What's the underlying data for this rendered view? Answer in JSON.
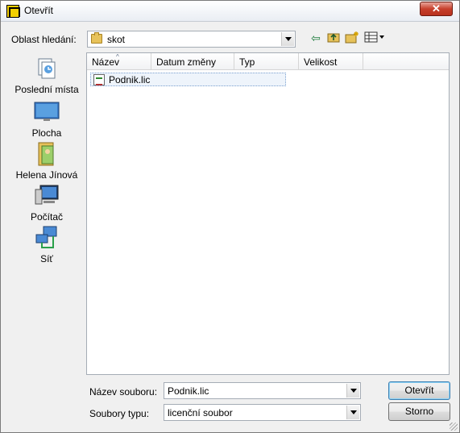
{
  "window": {
    "title": "Otevřít",
    "close_label": "✕"
  },
  "look_in": {
    "label": "Oblast hledání:",
    "value": "skot"
  },
  "toolbar": {
    "back_icon": "back-arrow-icon",
    "up_icon": "up-folder-icon",
    "new_folder_icon": "new-folder-icon",
    "views_icon": "views-menu-icon"
  },
  "places": [
    {
      "label": "Poslední místa",
      "icon": "recent-places-icon"
    },
    {
      "label": "Plocha",
      "icon": "desktop-icon"
    },
    {
      "label": "Helena Jínová",
      "icon": "user-folder-icon"
    },
    {
      "label": "Počítač",
      "icon": "computer-icon"
    },
    {
      "label": "Síť",
      "icon": "network-icon"
    }
  ],
  "columns": [
    "Název",
    "Datum změny",
    "Typ",
    "Velikost"
  ],
  "files": [
    {
      "name": "Podnik.lic",
      "icon": "license-file-icon"
    }
  ],
  "filename": {
    "label": "Název souboru:",
    "value": "Podnik.lic"
  },
  "filetype": {
    "label": "Soubory typu:",
    "value": "licenční soubor"
  },
  "buttons": {
    "open": "Otevřít",
    "cancel": "Storno"
  },
  "colors": {
    "accent": "#3c7fb1",
    "selection": "#eef4fb",
    "close": "#c7402c"
  }
}
